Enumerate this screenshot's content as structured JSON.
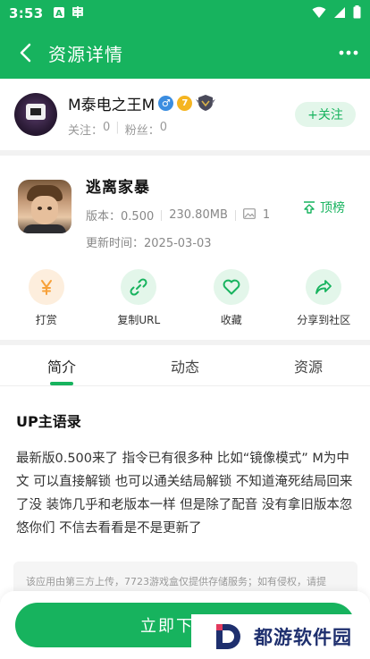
{
  "status_bar": {
    "time": "3:53",
    "icons": [
      "a-icon",
      "browser-icon",
      "wifi-icon",
      "signal-icon",
      "battery-icon"
    ]
  },
  "app_bar": {
    "title": "资源详情",
    "back_icon": "chevron-left-icon",
    "more_icon": "more-horizontal-icon"
  },
  "uploader": {
    "name": "M泰电之王M",
    "follows_label": "关注：",
    "follows": "0",
    "fans_label": "粉丝：",
    "fans": "0",
    "level": "7",
    "follow_button": "+关注"
  },
  "game": {
    "name": "逃离家暴",
    "version_label": "版本：",
    "version": "0.500",
    "size": "230.80MB",
    "images_count": "1",
    "updated_label": "更新时间：",
    "updated": "2025-03-03",
    "top_button": "顶榜"
  },
  "actions": [
    {
      "label": "打赏",
      "icon": "yen-icon",
      "color": "#f7a13a"
    },
    {
      "label": "复制URL",
      "icon": "link-icon",
      "color": "#17b35e"
    },
    {
      "label": "收藏",
      "icon": "heart-icon",
      "color": "#17b35e"
    },
    {
      "label": "分享到社区",
      "icon": "share-icon",
      "color": "#17b35e"
    }
  ],
  "tabs": [
    {
      "label": "简介",
      "active": true
    },
    {
      "label": "动态",
      "active": false
    },
    {
      "label": "资源",
      "active": false
    }
  ],
  "intro": {
    "title": "UP主语录",
    "body": "最新版0.500来了 指令已有很多种 比如“镜像模式” M为中文 可以直接解锁 也可以通关结局解锁 不知道淹死结局回来了没 装饰几乎和老版本一样 但是除了配音 没有拿旧版本忽悠你们 不信去看看是不是更新了"
  },
  "notice": "该应用由第三方上传，7723游戏盒仅提供存储服务；如有侵权，请提",
  "install_button": "立即下",
  "watermark": "都游软件园",
  "colors": {
    "primary": "#17b35e",
    "accent_orange": "#f7a13a"
  }
}
